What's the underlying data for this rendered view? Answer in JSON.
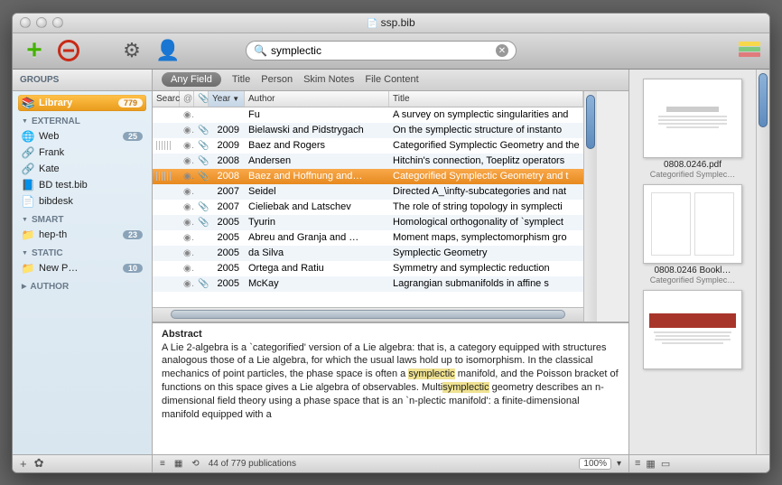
{
  "window": {
    "title": "ssp.bib"
  },
  "toolbar": {
    "search_value": "symplectic"
  },
  "sidebar": {
    "groups_label": "GROUPS",
    "library": {
      "label": "Library",
      "count": "779"
    },
    "external_label": "EXTERNAL",
    "external": [
      {
        "icon": "🌐",
        "label": "Web",
        "count": "25"
      },
      {
        "icon": "🔗",
        "label": "Frank"
      },
      {
        "icon": "🔗",
        "label": "Kate"
      },
      {
        "icon": "📘",
        "label": "BD test.bib"
      },
      {
        "icon": "📄",
        "label": "bibdesk"
      }
    ],
    "smart_label": "SMART",
    "smart": [
      {
        "icon": "📁",
        "label": "hep-th",
        "count": "23"
      }
    ],
    "static_label": "STATIC",
    "static": [
      {
        "icon": "📁",
        "label": "New P…",
        "count": "10"
      }
    ],
    "author_label": "AUTHOR"
  },
  "scope": {
    "active": "Any Field",
    "items": [
      "Title",
      "Person",
      "Skim Notes",
      "File Content"
    ]
  },
  "columns": {
    "search": "Searc",
    "at": "@",
    "clip": "📎",
    "year": "Year",
    "author": "Author",
    "title": "Title"
  },
  "rows": [
    {
      "search": "",
      "at": true,
      "clip": false,
      "year": "",
      "author": "Fu",
      "title": "A survey on symplectic singularities and"
    },
    {
      "search": "",
      "at": true,
      "clip": true,
      "year": "2009",
      "author": "Bielawski and Pidstrygach",
      "title": "On the symplectic structure of instanto"
    },
    {
      "search": "stripe",
      "at": true,
      "clip": true,
      "year": "2009",
      "author": "Baez and Rogers",
      "title": "Categorified Symplectic Geometry and the"
    },
    {
      "search": "",
      "at": true,
      "clip": true,
      "year": "2008",
      "author": "Andersen",
      "title": "Hitchin's connection, Toeplitz operators"
    },
    {
      "search": "stripe",
      "at": true,
      "clip": true,
      "year": "2008",
      "author": "Baez and Hoffnung and…",
      "title": "Categorified Symplectic Geometry and t",
      "selected": true
    },
    {
      "search": "",
      "at": true,
      "clip": false,
      "year": "2007",
      "author": "Seidel",
      "title": "Directed A_\\infty-subcategories and nat"
    },
    {
      "search": "",
      "at": true,
      "clip": true,
      "year": "2007",
      "author": "Cieliebak and Latschev",
      "title": "The role of string topology in symplecti"
    },
    {
      "search": "",
      "at": true,
      "clip": true,
      "year": "2005",
      "author": "Tyurin",
      "title": "Homological orthogonality of `symplect"
    },
    {
      "search": "",
      "at": true,
      "clip": false,
      "year": "2005",
      "author": "Abreu and Granja and …",
      "title": "Moment maps, symplectomorphism gro"
    },
    {
      "search": "",
      "at": true,
      "clip": false,
      "year": "2005",
      "author": "da Silva",
      "title": "Symplectic Geometry"
    },
    {
      "search": "",
      "at": true,
      "clip": false,
      "year": "2005",
      "author": "Ortega and Ratiu",
      "title": "Symmetry and symplectic reduction"
    },
    {
      "search": "",
      "at": true,
      "clip": true,
      "year": "2005",
      "author": "McKay",
      "title": "Lagrangian submanifolds in affine s"
    }
  ],
  "abstract": {
    "heading": "Abstract",
    "pre1": "A Lie 2-algebra is a `categorified' version of a Lie algebra: that is, a category equipped with structures analogous those of a Lie algebra, for which the usual laws hold up to isomorphism. In the classical mechanics of point particles, the phase space is often a ",
    "hl1": "symplectic",
    "mid1": " manifold, and the Poisson bracket of functions on this space gives a Lie algebra of observables. Multi",
    "hl2": "symplectic",
    "post1": " geometry describes an n-dimensional field theory using a phase space that is an `n-plectic manifold': a finite-dimensional manifold equipped with a"
  },
  "status": {
    "count": "44 of 779 publications",
    "zoom": "100%"
  },
  "previews": [
    {
      "name": "0808.0246.pdf",
      "sub": "Categorified Symplec…",
      "type": "doc"
    },
    {
      "name": "0808.0246 Bookl…",
      "sub": "Categorified Symplec…",
      "type": "spread"
    },
    {
      "name": "",
      "sub": "",
      "type": "web"
    }
  ]
}
